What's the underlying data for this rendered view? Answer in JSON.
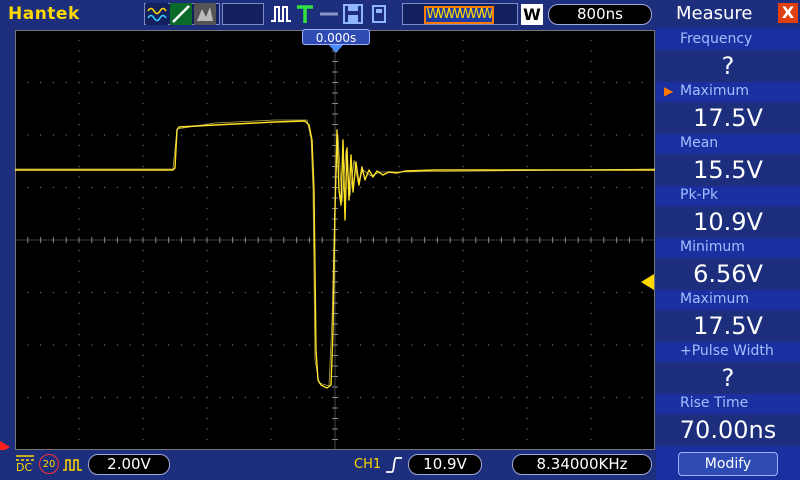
{
  "header": {
    "brand": "Hantek",
    "wave_indicator": "WWWWWW",
    "w_label": "W",
    "timebase": "800ns"
  },
  "screen": {
    "trigger_position": "0.000s"
  },
  "footer": {
    "coupling": "DC",
    "bw_limit": "20",
    "volts_per_div": "2.00V",
    "trigger_channel": "CH1",
    "trigger_level": "10.9V",
    "frequency": "8.34000KHz"
  },
  "measure": {
    "title": "Measure",
    "close": "X",
    "items": [
      {
        "label": "Frequency",
        "value": "?"
      },
      {
        "label": "Maximum",
        "value": "17.5V"
      },
      {
        "label": "Mean",
        "value": "15.5V"
      },
      {
        "label": "Pk-Pk",
        "value": "10.9V"
      },
      {
        "label": "Minimum",
        "value": "6.56V"
      },
      {
        "label": "Maximum",
        "value": "17.5V"
      },
      {
        "label": "+Pulse Width",
        "value": "?"
      },
      {
        "label": "Rise Time",
        "value": "70.00ns"
      }
    ],
    "modify_label": "Modify"
  },
  "colors": {
    "trace": "#ffe020",
    "background": "#1c2e7c",
    "panel": "#1a2fa0",
    "accent": "#ffd800",
    "close": "#e04010"
  }
}
